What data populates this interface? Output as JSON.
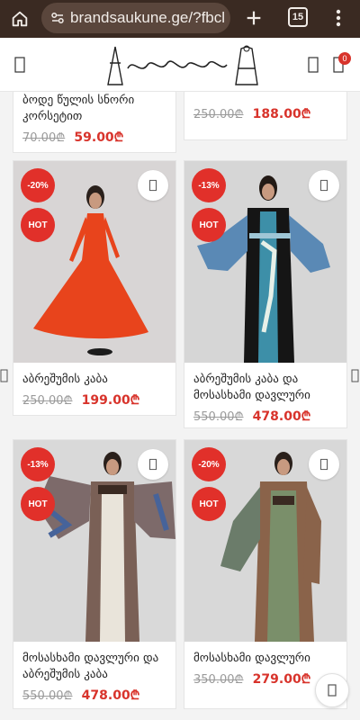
{
  "browser": {
    "url": "brandsaukune.ge/?fbcl",
    "tab_count": "15",
    "icons": {
      "home": "home-icon",
      "site_settings": "tune-icon",
      "new_tab": "plus-icon",
      "menu": "more-vert-icon"
    }
  },
  "header": {
    "cart_count": "0",
    "icons": {
      "menu": "hamburger-icon",
      "search": "search-icon",
      "cart": "cart-icon"
    }
  },
  "top_row": {
    "left": {
      "title": "ბოდე წულის სნორი კორსეტით",
      "old_price": "70.00₾",
      "new_price": "59.00₾"
    },
    "right": {
      "old_price": "250.00₾",
      "new_price": "188.00₾"
    }
  },
  "products": [
    {
      "title": "აბრეშუმის კაბა",
      "old_price": "250.00₾",
      "new_price": "199.00₾",
      "discount": "-20%",
      "hot": "HOT"
    },
    {
      "title": "აბრეშუმის კაბა და მოსასხამი დავლური",
      "old_price": "550.00₾",
      "new_price": "478.00₾",
      "discount": "-13%",
      "hot": "HOT"
    },
    {
      "title": "მოსასხამი დავლური და აბრეშუმის კაბა",
      "old_price": "550.00₾",
      "new_price": "478.00₾",
      "discount": "-13%",
      "hot": "HOT"
    },
    {
      "title": "მოსასხამი დავლური",
      "old_price": "350.00₾",
      "new_price": "279.00₾",
      "discount": "-20%",
      "hot": "HOT"
    }
  ],
  "colors": {
    "accent": "#e1302a",
    "price": "#d8332b",
    "chrome": "#3a2a22"
  }
}
